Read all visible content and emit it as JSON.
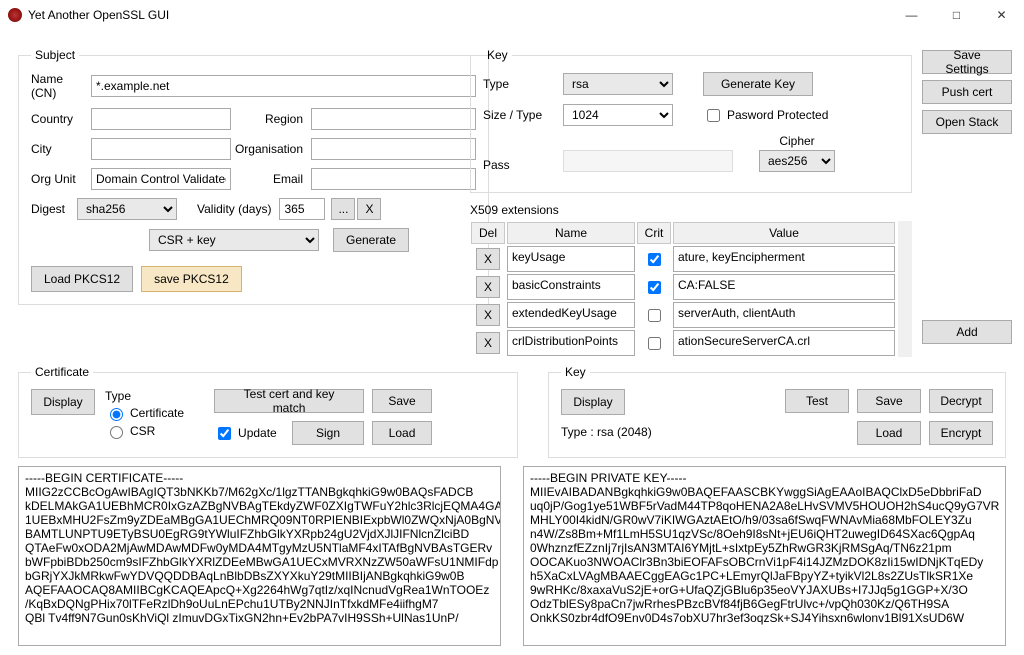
{
  "window": {
    "title": "Yet Another OpenSSL GUI"
  },
  "subject": {
    "legend": "Subject",
    "name_label": "Name (CN)",
    "name_value": "*.example.net",
    "country_label": "Country",
    "region_label": "Region",
    "city_label": "City",
    "organisation_label": "Organisation",
    "orgunit_label": "Org Unit",
    "orgunit_value": "Domain Control Validated",
    "email_label": "Email",
    "digest_label": "Digest",
    "digest_value": "sha256",
    "validity_label": "Validity (days)",
    "validity_value": "365",
    "mode_value": "CSR + key",
    "generate": "Generate",
    "dots": "...",
    "x": "X",
    "load_pkcs12": "Load PKCS12",
    "save_pkcs12": "save PKCS12"
  },
  "key": {
    "legend": "Key",
    "type_label": "Type",
    "type_value": "rsa",
    "generate_key": "Generate Key",
    "size_label": "Size / Type",
    "size_value": "1024",
    "pwd_protected": "Pasword Protected",
    "pass_label": "Pass",
    "cipher_label": "Cipher",
    "cipher_value": "aes256"
  },
  "rightbtns": {
    "save_settings": "Save Settings",
    "push_cert": "Push cert",
    "open_stack": "Open Stack"
  },
  "ext": {
    "title": "X509 extensions",
    "hd_del": "Del",
    "hd_name": "Name",
    "hd_crit": "Crit",
    "hd_value": "Value",
    "rows": [
      {
        "x": "X",
        "name": "keyUsage",
        "crit": true,
        "value": "ature, keyEncipherment"
      },
      {
        "x": "X",
        "name": "basicConstraints",
        "crit": true,
        "value": "CA:FALSE"
      },
      {
        "x": "X",
        "name": "extendedKeyUsage",
        "crit": false,
        "value": "serverAuth, clientAuth"
      },
      {
        "x": "X",
        "name": "crlDistributionPoints",
        "crit": false,
        "value": "ationSecureServerCA.crl"
      }
    ],
    "add": "Add"
  },
  "cert_panel": {
    "legend": "Certificate",
    "display": "Display",
    "type_label": "Type",
    "r_cert": "Certificate",
    "r_csr": "CSR",
    "test_match": "Test cert and key match",
    "save": "Save",
    "update": "Update",
    "sign": "Sign",
    "load": "Load"
  },
  "key_panel": {
    "legend": "Key",
    "display": "Display",
    "type_line": "Type :   rsa (2048)",
    "test": "Test",
    "save": "Save",
    "decrypt": "Decrypt",
    "load": "Load",
    "encrypt": "Encrypt"
  },
  "cert_text": "-----BEGIN CERTIFICATE-----\nMIIG2zCCBcOgAwIBAgIQT3bNKKb7/M62gXc/1lgzTTANBgkqhkiG9w0BAQsFADCB\nkDELMAkGA1UEBhMCR0IxGzAZBgNVBAgTEkdyZWF0ZXIgTWFuY2hlc3RlcjEQMA4GA\n1UEBxMHU2FsZm9yZDEaMBgGA1UEChMRQ09NT0RPIENBIExpbWl0ZWQxNjA0BgNV\nBAMTLUNPTU9ETyBSU0EgRG9tYWluIFZhbGlkYXRpb24gU2VjdXJlJIFNlcnZlciBD\nQTAeFw0xODA2MjAwMDAwMDFw0yMDA4MTgyMzU5NTlaMF4xITAfBgNVBAsTGERv\nbWFpbiBDb250cm9sIFZhbGlkYXRlZDEeMBwGA1UECxMVRXNzZW50aWFsU1NMIFdp\nbGRjYXJkMRkwFwYDVQQDDBAqLnBlbDBsZXYXkuY29tMIIBIjANBgkqhkiG9w0B\nAQEFAAOCAQ8AMIIBCgKCAQEApcQ+Xg2264hWg7qtIz/xqINcnudVgRea1WnTOOEz\n/KqBxDQNgPHix70lTFeRzlDh9oUuLnEPchu1UTBy2NNJInTfxkdMFe4iifhgM7\nQBl Tv4ff9N7Gun0sKhViQl zImuvDGxTixGN2hn+Ev2bPA7vIH9SSh+UlNas1UnP/",
  "key_text": "-----BEGIN PRIVATE KEY-----\nMIIEvAIBADANBgkqhkiG9w0BAQEFAASCBKYwggSiAgEAAoIBAQClxD5eDbbriFaD\nuq0jP/Gog1ye51WBF5rVadM44TP8qoHENA2A8eLHvSVMV5HOUOH2hS4ucQ9yG7VR\nMHLY00I4kidN/GR0wV7iKIWGAztAEtO/h9/03sa6fSwqFWNAvMia68MbFOLEY3Zu\nn4W/Zs8Bm+Mf1LmH5SU1qzVSc/8Oeh9I8sNt+jEU6iQHT2uwegID64SXac6QgpAq\n0WhznzfEZznIj7rjIsAN3MTAI6YMjtL+sIxtpEy5ZhRwGR3KjRMSgAq/TN6z21pm\nOOCAKuo3NWOAClr3Bn3biEOFAFsOBCrnVi1pF4i14JZMzDOK8zIi15wIDNjKTqEDy\nh5XaCxLVAgMBAAECggEAGc1PC+LEmyrQlJaFBpyYZ+tyikVl2L8s2ZUsTlkSR1Xe\n9wRHKc/8xaxaVuS2jE+orG+UfaQZjGBlu6p35eoVYJAXUBs+I7JJq5g1GGP+X/3O\nOdzTblESy8paCn7jwRrhesPBzcBVf84fjB6GegFtrUlvc+/vpQh030Kz/Q6TH9SA\nOnkKS0zbr4dfO9Env0D4s7obXU7hr3ef3oqzSk+SJ4Yihsxn6wlonv1Bl91XsUD6W"
}
